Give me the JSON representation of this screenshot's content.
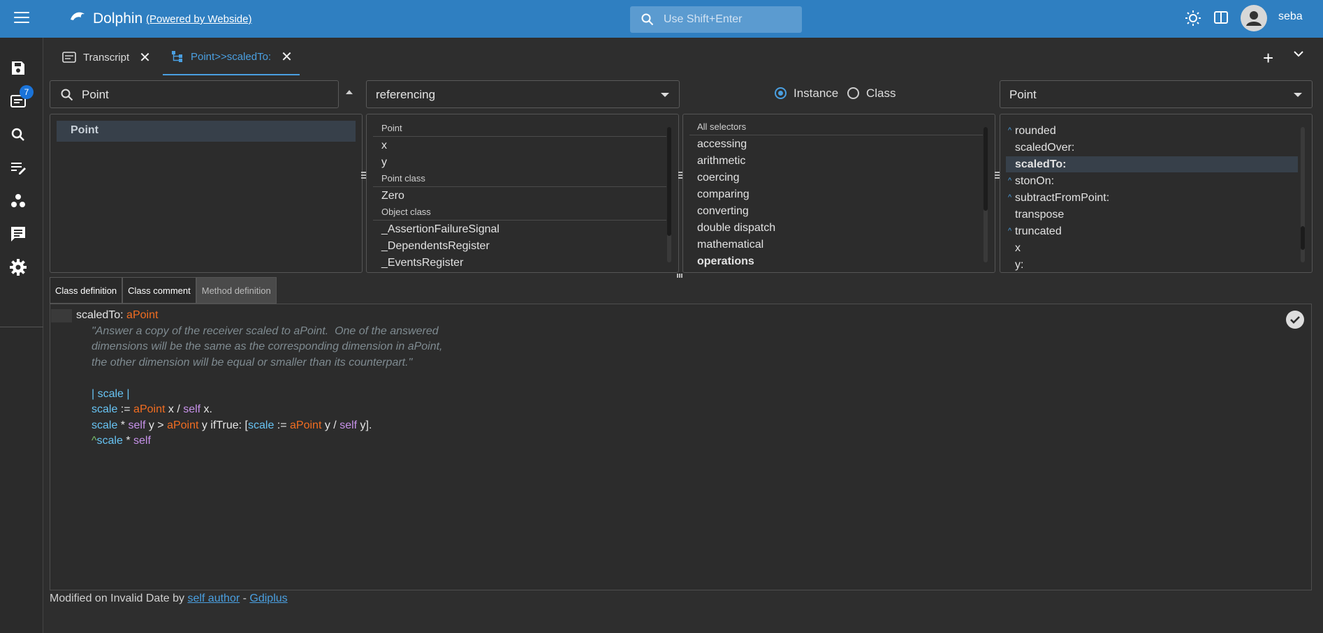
{
  "header": {
    "menu_icon": "hamburger-icon",
    "logo_icon": "dolphin-logo",
    "title": "Dolphin",
    "powered_by": "(Powered by Webside)",
    "search_placeholder": "Use Shift+Enter",
    "user": "seba"
  },
  "sidebar": {
    "items": [
      {
        "icon": "save-icon"
      },
      {
        "icon": "transcript-icon",
        "badge": "7"
      },
      {
        "icon": "search-icon"
      },
      {
        "icon": "edit-list-icon"
      },
      {
        "icon": "workspaces-icon"
      },
      {
        "icon": "chat-icon"
      },
      {
        "icon": "gear-icon"
      }
    ]
  },
  "tabs": [
    {
      "label": "Transcript",
      "active": false
    },
    {
      "label": "Point>>scaledTo:",
      "active": true
    }
  ],
  "browser": {
    "class_filter": "Point",
    "variables_filter": "referencing",
    "side": {
      "instance_label": "Instance",
      "class_label": "Class",
      "selected": "Instance"
    },
    "method_class": "Point",
    "classes": [
      "Point"
    ],
    "variables": {
      "groups": [
        {
          "name": "Point",
          "items": [
            "x",
            "y"
          ]
        },
        {
          "name": "Point class",
          "items": [
            "Zero"
          ]
        },
        {
          "name": "Object class",
          "items": [
            "_AssertionFailureSignal",
            "_DependentsRegister",
            "_EventsRegister"
          ]
        }
      ]
    },
    "categories": {
      "header": "All selectors",
      "items": [
        "accessing",
        "arithmetic",
        "coercing",
        "comparing",
        "converting",
        "double dispatch",
        "mathematical",
        "operations"
      ],
      "selected": "operations"
    },
    "methods": {
      "items": [
        "rounded",
        "scaledOver:",
        "scaledTo:",
        "stonOn:",
        "subtractFromPoint:",
        "transpose",
        "truncated",
        "x",
        "y:"
      ],
      "overrides": [
        "rounded",
        "stonOn:",
        "subtractFromPoint:",
        "truncated"
      ],
      "selected": "scaledTo:"
    }
  },
  "source_tabs": [
    "Class definition",
    "Class comment",
    "Method definition"
  ],
  "source": {
    "selector": "scaledTo:",
    "arg": "aPoint",
    "comment": [
      "\"Answer a copy of the receiver scaled to aPoint.  One of the answered",
      "dimensions will be the same as the corresponding dimension in aPoint,",
      "the other dimension will be equal or smaller than its counterpart.\""
    ],
    "temps_line": "| scale |",
    "line1": {
      "a": "scale",
      "b": " := ",
      "c": "aPoint",
      "d": " x / ",
      "e": "self",
      "f": " x."
    },
    "line2": {
      "a": "scale",
      "b": " * ",
      "c": "self",
      "d": " y > ",
      "e": "aPoint",
      "f": " y ifTrue: [",
      "g": "scale",
      "h": " := ",
      "i": "aPoint",
      "j": " y / ",
      "k": "self",
      "l": " y]."
    },
    "line3": {
      "a": "^",
      "b": "scale",
      "c": " * ",
      "d": "self"
    }
  },
  "footer": {
    "prefix": "Modified on Invalid Date by",
    "author": "self author",
    "sep": "-",
    "package": "Gdiplus"
  }
}
